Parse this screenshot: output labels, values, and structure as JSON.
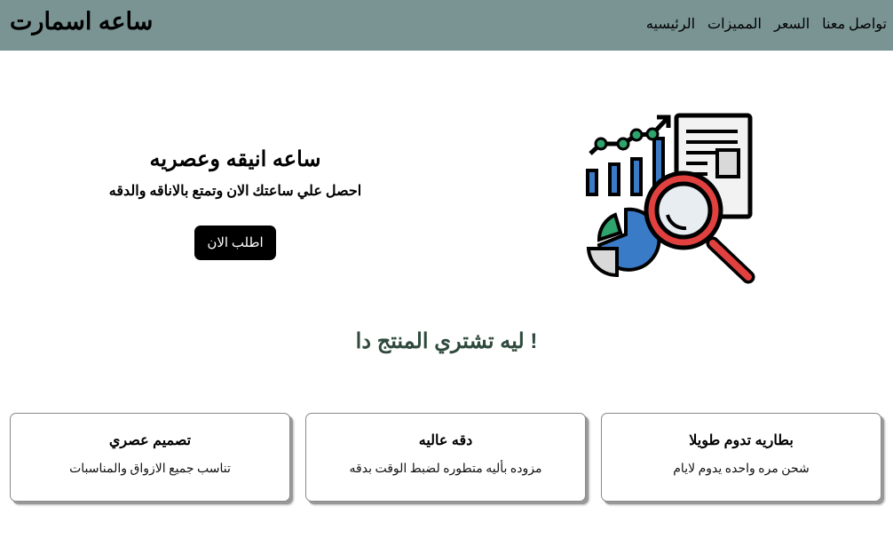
{
  "navbar": {
    "brand": "ساعه اسمارت",
    "links": [
      "الرئيسيه",
      "المميزات",
      "السعر",
      "تواصل معنا"
    ]
  },
  "hero": {
    "title": "ساعه انيقه وعصريه",
    "subtitle": "احصل علي ساعتك الان وتمتع بالاناقه والدقه",
    "button_label": "اطلب الان",
    "illustration_icon": "analytics-magnifier-icon"
  },
  "features": {
    "title": "! ليه تشتري المنتج دا",
    "cards": [
      {
        "title": "بطاريه تدوم طويلا",
        "desc": "شحن مره واحده يدوم لايام"
      },
      {
        "title": "دقه عاليه",
        "desc": "مزوده بأليه متطوره لضبط الوقت بدقه"
      },
      {
        "title": "تصميم عصري",
        "desc": "تناسب جميع الازواق والمناسبات"
      }
    ]
  },
  "colors": {
    "navbar_bg": "#7a9494",
    "section_title": "#2f4a3d",
    "button_bg": "#000000"
  }
}
